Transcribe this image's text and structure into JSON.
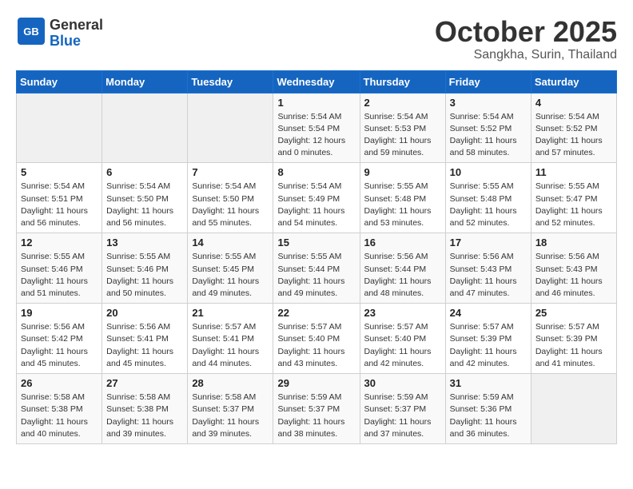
{
  "header": {
    "logo_general": "General",
    "logo_blue": "Blue",
    "month": "October 2025",
    "location": "Sangkha, Surin, Thailand"
  },
  "days_of_week": [
    "Sunday",
    "Monday",
    "Tuesday",
    "Wednesday",
    "Thursday",
    "Friday",
    "Saturday"
  ],
  "weeks": [
    [
      {
        "day": "",
        "info": ""
      },
      {
        "day": "",
        "info": ""
      },
      {
        "day": "",
        "info": ""
      },
      {
        "day": "1",
        "info": "Sunrise: 5:54 AM\nSunset: 5:54 PM\nDaylight: 12 hours\nand 0 minutes."
      },
      {
        "day": "2",
        "info": "Sunrise: 5:54 AM\nSunset: 5:53 PM\nDaylight: 11 hours\nand 59 minutes."
      },
      {
        "day": "3",
        "info": "Sunrise: 5:54 AM\nSunset: 5:52 PM\nDaylight: 11 hours\nand 58 minutes."
      },
      {
        "day": "4",
        "info": "Sunrise: 5:54 AM\nSunset: 5:52 PM\nDaylight: 11 hours\nand 57 minutes."
      }
    ],
    [
      {
        "day": "5",
        "info": "Sunrise: 5:54 AM\nSunset: 5:51 PM\nDaylight: 11 hours\nand 56 minutes."
      },
      {
        "day": "6",
        "info": "Sunrise: 5:54 AM\nSunset: 5:50 PM\nDaylight: 11 hours\nand 56 minutes."
      },
      {
        "day": "7",
        "info": "Sunrise: 5:54 AM\nSunset: 5:50 PM\nDaylight: 11 hours\nand 55 minutes."
      },
      {
        "day": "8",
        "info": "Sunrise: 5:54 AM\nSunset: 5:49 PM\nDaylight: 11 hours\nand 54 minutes."
      },
      {
        "day": "9",
        "info": "Sunrise: 5:55 AM\nSunset: 5:48 PM\nDaylight: 11 hours\nand 53 minutes."
      },
      {
        "day": "10",
        "info": "Sunrise: 5:55 AM\nSunset: 5:48 PM\nDaylight: 11 hours\nand 52 minutes."
      },
      {
        "day": "11",
        "info": "Sunrise: 5:55 AM\nSunset: 5:47 PM\nDaylight: 11 hours\nand 52 minutes."
      }
    ],
    [
      {
        "day": "12",
        "info": "Sunrise: 5:55 AM\nSunset: 5:46 PM\nDaylight: 11 hours\nand 51 minutes."
      },
      {
        "day": "13",
        "info": "Sunrise: 5:55 AM\nSunset: 5:46 PM\nDaylight: 11 hours\nand 50 minutes."
      },
      {
        "day": "14",
        "info": "Sunrise: 5:55 AM\nSunset: 5:45 PM\nDaylight: 11 hours\nand 49 minutes."
      },
      {
        "day": "15",
        "info": "Sunrise: 5:55 AM\nSunset: 5:44 PM\nDaylight: 11 hours\nand 49 minutes."
      },
      {
        "day": "16",
        "info": "Sunrise: 5:56 AM\nSunset: 5:44 PM\nDaylight: 11 hours\nand 48 minutes."
      },
      {
        "day": "17",
        "info": "Sunrise: 5:56 AM\nSunset: 5:43 PM\nDaylight: 11 hours\nand 47 minutes."
      },
      {
        "day": "18",
        "info": "Sunrise: 5:56 AM\nSunset: 5:43 PM\nDaylight: 11 hours\nand 46 minutes."
      }
    ],
    [
      {
        "day": "19",
        "info": "Sunrise: 5:56 AM\nSunset: 5:42 PM\nDaylight: 11 hours\nand 45 minutes."
      },
      {
        "day": "20",
        "info": "Sunrise: 5:56 AM\nSunset: 5:41 PM\nDaylight: 11 hours\nand 45 minutes."
      },
      {
        "day": "21",
        "info": "Sunrise: 5:57 AM\nSunset: 5:41 PM\nDaylight: 11 hours\nand 44 minutes."
      },
      {
        "day": "22",
        "info": "Sunrise: 5:57 AM\nSunset: 5:40 PM\nDaylight: 11 hours\nand 43 minutes."
      },
      {
        "day": "23",
        "info": "Sunrise: 5:57 AM\nSunset: 5:40 PM\nDaylight: 11 hours\nand 42 minutes."
      },
      {
        "day": "24",
        "info": "Sunrise: 5:57 AM\nSunset: 5:39 PM\nDaylight: 11 hours\nand 42 minutes."
      },
      {
        "day": "25",
        "info": "Sunrise: 5:57 AM\nSunset: 5:39 PM\nDaylight: 11 hours\nand 41 minutes."
      }
    ],
    [
      {
        "day": "26",
        "info": "Sunrise: 5:58 AM\nSunset: 5:38 PM\nDaylight: 11 hours\nand 40 minutes."
      },
      {
        "day": "27",
        "info": "Sunrise: 5:58 AM\nSunset: 5:38 PM\nDaylight: 11 hours\nand 39 minutes."
      },
      {
        "day": "28",
        "info": "Sunrise: 5:58 AM\nSunset: 5:37 PM\nDaylight: 11 hours\nand 39 minutes."
      },
      {
        "day": "29",
        "info": "Sunrise: 5:59 AM\nSunset: 5:37 PM\nDaylight: 11 hours\nand 38 minutes."
      },
      {
        "day": "30",
        "info": "Sunrise: 5:59 AM\nSunset: 5:37 PM\nDaylight: 11 hours\nand 37 minutes."
      },
      {
        "day": "31",
        "info": "Sunrise: 5:59 AM\nSunset: 5:36 PM\nDaylight: 11 hours\nand 36 minutes."
      },
      {
        "day": "",
        "info": ""
      }
    ]
  ]
}
